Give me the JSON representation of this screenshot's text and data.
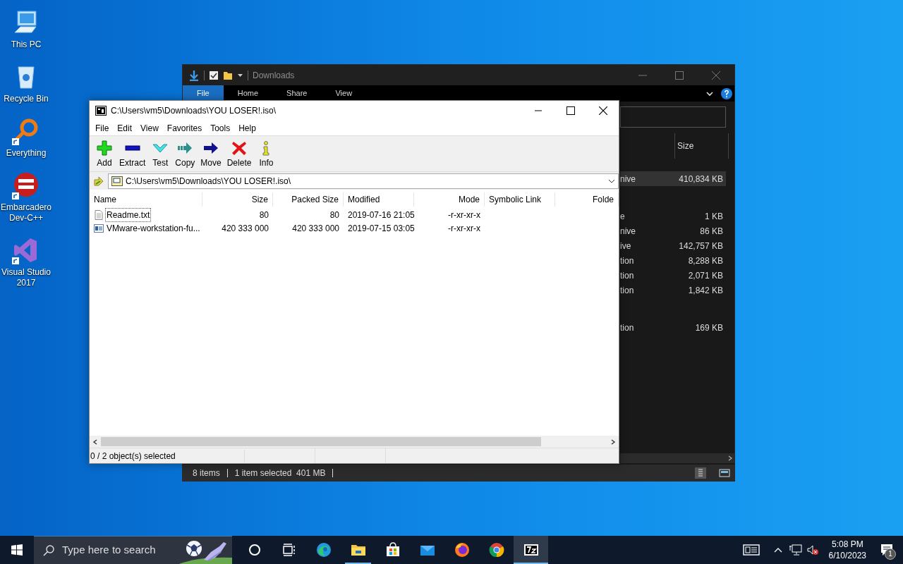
{
  "desktop_icons": [
    {
      "label": "This PC",
      "kind": "pc",
      "shortcut": false
    },
    {
      "label": "Recycle Bin",
      "kind": "bin",
      "shortcut": false
    },
    {
      "label": "Everything",
      "kind": "everything",
      "shortcut": true
    },
    {
      "label": "Embarcadero Dev-C++",
      "kind": "devcpp",
      "shortcut": true
    },
    {
      "label": "Visual Studio 2017",
      "kind": "vs",
      "shortcut": true
    }
  ],
  "explorer": {
    "title": "Downloads",
    "ribbon_tabs": [
      {
        "label": "File",
        "selected": true
      },
      {
        "label": "Home",
        "selected": false
      },
      {
        "label": "Share",
        "selected": false
      },
      {
        "label": "View",
        "selected": false
      }
    ],
    "column": "Size",
    "groups": [
      {
        "rows": [
          {
            "type": "nive",
            "size": "410,834 KB",
            "selected": true
          }
        ]
      },
      {
        "rows": [
          {
            "type": "e",
            "size": "1 KB",
            "selected": false
          },
          {
            "type": "nive",
            "size": "86 KB",
            "selected": false
          },
          {
            "type": "ive",
            "size": "142,757 KB",
            "selected": false
          },
          {
            "type": "tion",
            "size": "8,288 KB",
            "selected": false
          },
          {
            "type": "tion",
            "size": "2,071 KB",
            "selected": false
          },
          {
            "type": "tion",
            "size": "1,842 KB",
            "selected": false
          }
        ]
      },
      {
        "rows": [
          {
            "type": "tion",
            "size": "169 KB",
            "selected": false
          }
        ]
      }
    ],
    "status": [
      "8 items",
      "1 item selected  401 MB"
    ]
  },
  "sevenzip": {
    "title": "C:\\Users\\vm5\\Downloads\\YOU LOSER!.iso\\",
    "menu": [
      "File",
      "Edit",
      "View",
      "Favorites",
      "Tools",
      "Help"
    ],
    "toolbar": [
      {
        "label": "Add",
        "kind": "add"
      },
      {
        "label": "Extract",
        "kind": "extract"
      },
      {
        "label": "Test",
        "kind": "test"
      },
      {
        "label": "Copy",
        "kind": "copy"
      },
      {
        "label": "Move",
        "kind": "move"
      },
      {
        "label": "Delete",
        "kind": "delete"
      },
      {
        "label": "Info",
        "kind": "info"
      }
    ],
    "path": "C:\\Users\\vm5\\Downloads\\YOU LOSER!.iso\\",
    "columns": [
      "Name",
      "Size",
      "Packed Size",
      "Modified",
      "Mode",
      "Symbolic Link",
      "Folde"
    ],
    "rows": [
      {
        "kind": "text",
        "name": "Readme.txt",
        "size": "80",
        "packed": "80",
        "modified": "2019-07-16 21:05",
        "mode": "-r-xr-xr-x",
        "focused": true
      },
      {
        "kind": "app",
        "name": "VMware-workstation-fu...",
        "size": "420 333 000",
        "packed": "420 333 000",
        "modified": "2019-07-15 03:05",
        "mode": "-r-xr-xr-x",
        "focused": false
      }
    ],
    "status": "0 / 2 object(s) selected"
  },
  "taskbar": {
    "search_placeholder": "Type here to search",
    "apps": [
      {
        "kind": "cortana",
        "active": false
      },
      {
        "kind": "taskview",
        "active": false
      },
      {
        "kind": "edge",
        "active": false
      },
      {
        "kind": "explorer",
        "active": false,
        "running": true
      },
      {
        "kind": "store",
        "active": false
      },
      {
        "kind": "mail",
        "active": false
      },
      {
        "kind": "firefox",
        "active": false
      },
      {
        "kind": "chrome",
        "active": false
      },
      {
        "kind": "sevenzip",
        "active": true,
        "running": true
      }
    ],
    "time": "5:08 PM",
    "date": "6/10/2023",
    "notifications": "1"
  }
}
